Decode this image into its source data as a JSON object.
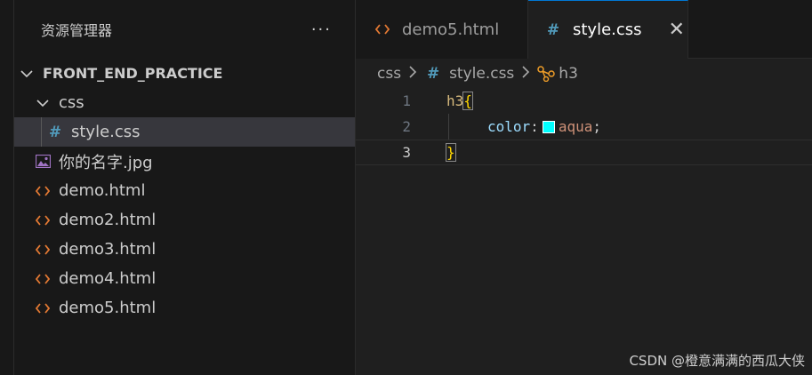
{
  "sidebar": {
    "title": "资源管理器",
    "more_label": "···",
    "project": {
      "name": "FRONT_END_PRACTICE",
      "icon": "chevron-down-icon"
    },
    "folder": {
      "name": "css",
      "icon": "chevron-down-icon"
    },
    "nested_file": {
      "name": "style.css",
      "icon": "css-hash-icon"
    },
    "files": [
      {
        "name": "你的名字.jpg",
        "icon": "image-file-icon"
      },
      {
        "name": "demo.html",
        "icon": "html-file-icon"
      },
      {
        "name": "demo2.html",
        "icon": "html-file-icon"
      },
      {
        "name": "demo3.html",
        "icon": "html-file-icon"
      },
      {
        "name": "demo4.html",
        "icon": "html-file-icon"
      },
      {
        "name": "demo5.html",
        "icon": "html-file-icon"
      }
    ]
  },
  "tabs": [
    {
      "label": "demo5.html",
      "icon": "html-file-icon",
      "active": false
    },
    {
      "label": "style.css",
      "icon": "css-hash-icon",
      "active": true,
      "close": "✕"
    }
  ],
  "breadcrumb": {
    "folder": "css",
    "file": "style.css",
    "symbol": "h3",
    "symbol_icon": "symbol-class-icon"
  },
  "code": {
    "line_numbers": [
      "1",
      "2",
      "3"
    ],
    "selector": "h3",
    "open_brace": "{",
    "property": "color",
    "colon": ":",
    "value": "aqua",
    "semicolon": ";",
    "close_brace": "}",
    "swatch_color": "#00ffff"
  },
  "watermark": "CSDN @橙意满满的西瓜大侠",
  "colors": {
    "accent": "#0078d4",
    "html_icon": "#e37933",
    "css_icon": "#519aba",
    "image_icon": "#a074c4"
  }
}
